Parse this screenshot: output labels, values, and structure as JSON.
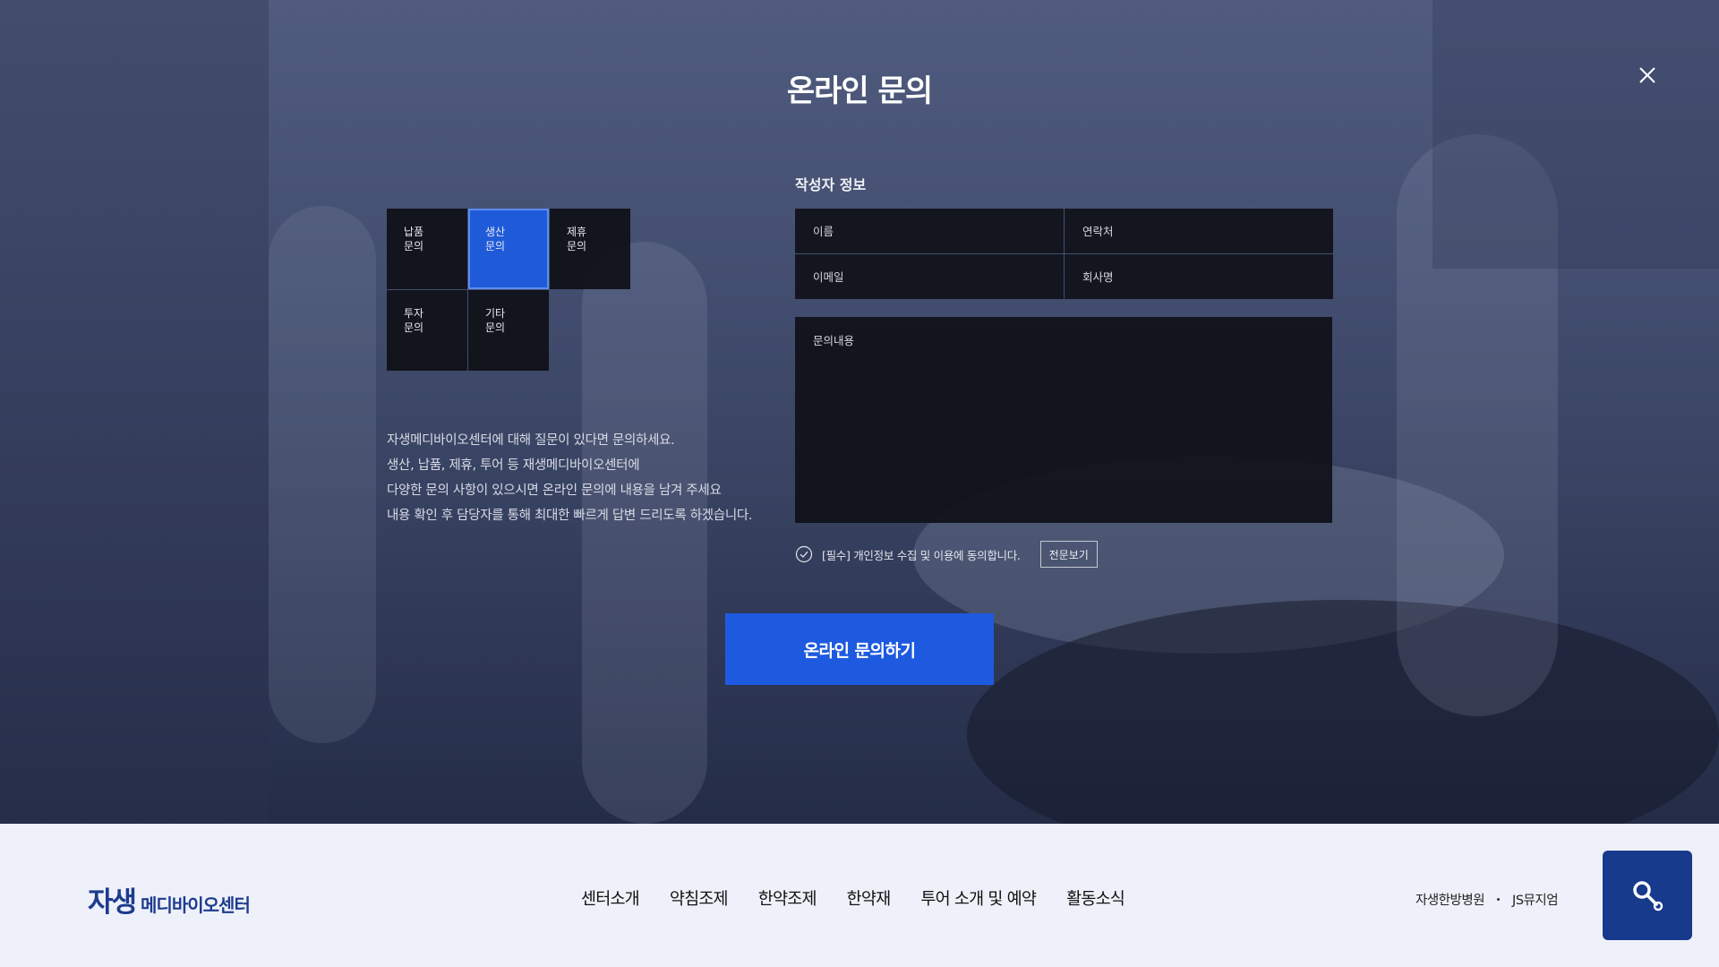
{
  "modal": {
    "title": "온라인 문의",
    "close_icon": "close-icon"
  },
  "categories": [
    {
      "label": "납품\n문의",
      "active": false
    },
    {
      "label": "생산\n문의",
      "active": true
    },
    {
      "label": "제휴\n문의",
      "active": false
    },
    {
      "label": "투자\n문의",
      "active": false
    },
    {
      "label": "기타\n문의",
      "active": false
    }
  ],
  "intro": {
    "lines": [
      "자생메디바이오센터에 대해 질문이 있다면 문의하세요.",
      "생산, 납품, 제휴, 투어 등 재생메디바이오센터에",
      "다양한 문의 사항이 있으시면 온라인 문의에 내용을 남겨 주세요",
      "내용 확인 후 담당자를 통해 최대한 빠르게 답변 드리도록 하겠습니다."
    ]
  },
  "form": {
    "section_title": "작성자 정보",
    "name_placeholder": "이름",
    "phone_placeholder": "연락처",
    "email_placeholder": "이메일",
    "company_placeholder": "회사명",
    "message_placeholder": "문의내용",
    "agree_text": "[필수] 개인정보 수집 및 이용에 동의합니다.",
    "view_full_label": "전문보기",
    "submit_label": "온라인 문의하기"
  },
  "footer": {
    "logo_main": "자생",
    "logo_sub": "메디바이오센터",
    "nav": [
      "센터소개",
      "약침조제",
      "한약조제",
      "한약재",
      "투어 소개 및 예약",
      "활동소식"
    ],
    "family_links": [
      "자생한방병원",
      "JS뮤지엄"
    ],
    "search_icon": "search-key-icon"
  },
  "colors": {
    "accent": "#1e5ae0",
    "active_category": "#1f5bd8",
    "brand_navy": "#173a8c",
    "footer_bg": "#eef1f9"
  }
}
